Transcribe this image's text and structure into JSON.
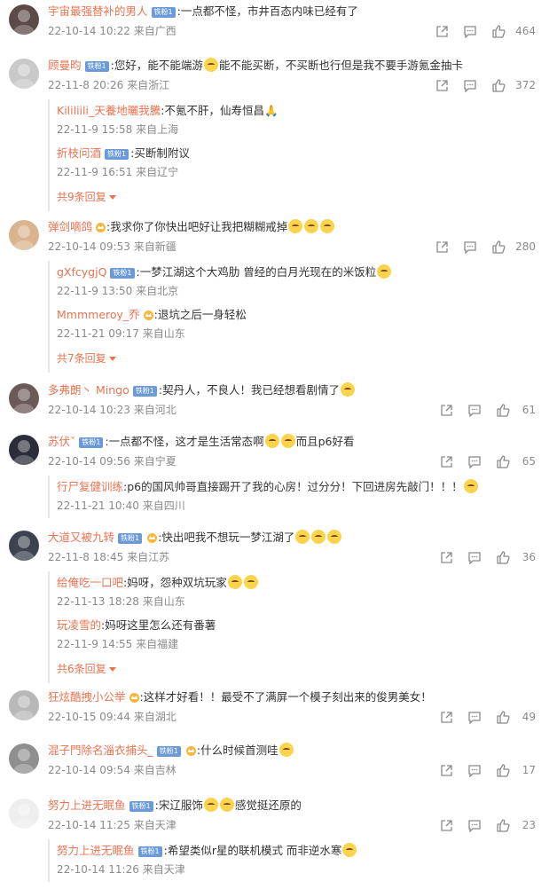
{
  "comments": [
    {
      "user": "宇宙最强替补的男人",
      "badge": "铁粉1",
      "crown": false,
      "text": ":一点都不怪，市井百态内味已经有了",
      "emojis": 0,
      "time": "22-10-14 10:22",
      "location": "来自广西",
      "likes": "464",
      "replies": [],
      "more": ""
    },
    {
      "user": "顾曼昀",
      "badge": "铁粉1",
      "crown": false,
      "text": ":您好，能不能端游",
      "emojis": 0,
      "text2": "能不能买断，不买断也行但是我不要手游氪金抽卡",
      "time": "22-11-8 20:26",
      "location": "来自浙江",
      "likes": "372",
      "replies": [
        {
          "user": "Kililiili_天養地曬我騰",
          "badge": "",
          "crown": false,
          "text": ":不氪不肝，仙寿恒昌🙏",
          "time": "22-11-9 15:58",
          "location": "来自上海"
        },
        {
          "user": "折枝问酒",
          "badge": "铁粉1",
          "crown": false,
          "text": ":买断制附议",
          "time": "22-11-9 16:51",
          "location": "来自辽宁"
        }
      ],
      "more": "共9条回复"
    },
    {
      "user": "弹剑嘀鸽",
      "badge": "",
      "crown": true,
      "text": ":我求你了你快出吧好让我把糊糊戒掉",
      "emojis": 3,
      "time": "22-10-14 09:53",
      "location": "来自新疆",
      "likes": "280",
      "replies": [
        {
          "user": "gXfcygjQ",
          "badge": "铁粉1",
          "crown": false,
          "text": ":一梦江湖这个大鸡肋 曾经的白月光现在的米饭粒",
          "emojis": 1,
          "time": "22-11-9 13:50",
          "location": "来自北京"
        },
        {
          "user": "Mmmmeroy_乔",
          "badge": "",
          "crown": true,
          "text": ":退坑之后一身轻松",
          "time": "22-11-21 09:17",
          "location": "来自山东"
        }
      ],
      "more": "共7条回复"
    },
    {
      "user": "多弗朗丶 Mingo",
      "badge": "铁粉1",
      "crown": false,
      "text": ":契丹人，不良人！我已经想看剧情了",
      "emojis": 1,
      "time": "22-10-14 10:23",
      "location": "来自河北",
      "likes": "61",
      "replies": [],
      "more": ""
    },
    {
      "user": "苏伏ˇ",
      "badge": "铁粉1",
      "crown": false,
      "text": ":一点都不怪，这才是生活常态啊",
      "emojis": 1,
      "text2": "而且p6好看",
      "time": "22-10-14 09:56",
      "location": "来自宁夏",
      "likes": "65",
      "replies": [
        {
          "user": "行尸复健训练",
          "badge": "",
          "crown": false,
          "text": ":p6的国风帅哥直接踢开了我的心房！过分分！下回进房先敲门！！！",
          "emojis": 1,
          "time": "22-11-21 10:40",
          "location": "来自四川"
        }
      ],
      "more": ""
    },
    {
      "user": "大道又被九转",
      "badge": "铁粉1",
      "crown": true,
      "text": ":快出吧我不想玩一梦江湖了",
      "emojis": 3,
      "time": "22-11-8 18:45",
      "location": "来自江苏",
      "likes": "36",
      "replies": [
        {
          "user": "给俺吃一口吧",
          "badge": "",
          "crown": false,
          "text": ":妈呀，怨种双坑玩家",
          "emojis": 2,
          "time": "22-11-13 18:28",
          "location": "来自山东"
        },
        {
          "user": "玩凌雪的",
          "badge": "",
          "crown": false,
          "text": ":妈呀这里怎么还有番薯",
          "time": "22-11-9 14:55",
          "location": "来自福建"
        }
      ],
      "more": "共6条回复"
    },
    {
      "user": "狂炫酷拽小公举",
      "badge": "",
      "crown": true,
      "text": ":这样才好看！！最受不了满屏一个模子刻出来的俊男美女！",
      "emojis": 0,
      "time": "22-10-15 09:44",
      "location": "来自湖北",
      "likes": "49",
      "replies": [],
      "more": ""
    },
    {
      "user": "混子門除名淄衣捕头_",
      "badge": "铁粉1",
      "crown": true,
      "text": ":什么时候首测哇",
      "emojis": 1,
      "time": "22-10-14 09:54",
      "location": "来自吉林",
      "likes": "17",
      "replies": [],
      "more": ""
    },
    {
      "user": "努力上进无眠鱼",
      "badge": "铁粉1",
      "crown": false,
      "text": ":宋辽服饰",
      "emojis": 1,
      "text2": "感觉挺还原的",
      "time": "22-10-14 11:25",
      "location": "来自天津",
      "likes": "23",
      "replies": [
        {
          "user": "努力上进无眠鱼",
          "badge": "铁粉1",
          "crown": false,
          "text": ":希望类似r星的联机模式 而非逆水寒",
          "emojis": 1,
          "time": "22-10-14 11:26",
          "location": "来自天津"
        }
      ],
      "more": ""
    }
  ],
  "avatars": [
    "#5c4a48",
    "#c9c9c9",
    "#d9b48f",
    "#6b5a57",
    "#2b2d3a",
    "#3d4250",
    "#b8b8b8",
    "#8f8f8f",
    "#eeeeee"
  ],
  "icons": {
    "share": "share-icon",
    "reply": "comment-icon",
    "like": "thumbs-up-icon"
  },
  "colors": {
    "username": "#eb7350",
    "meta": "#8a8a8a",
    "badge": "#6a9ad7"
  }
}
